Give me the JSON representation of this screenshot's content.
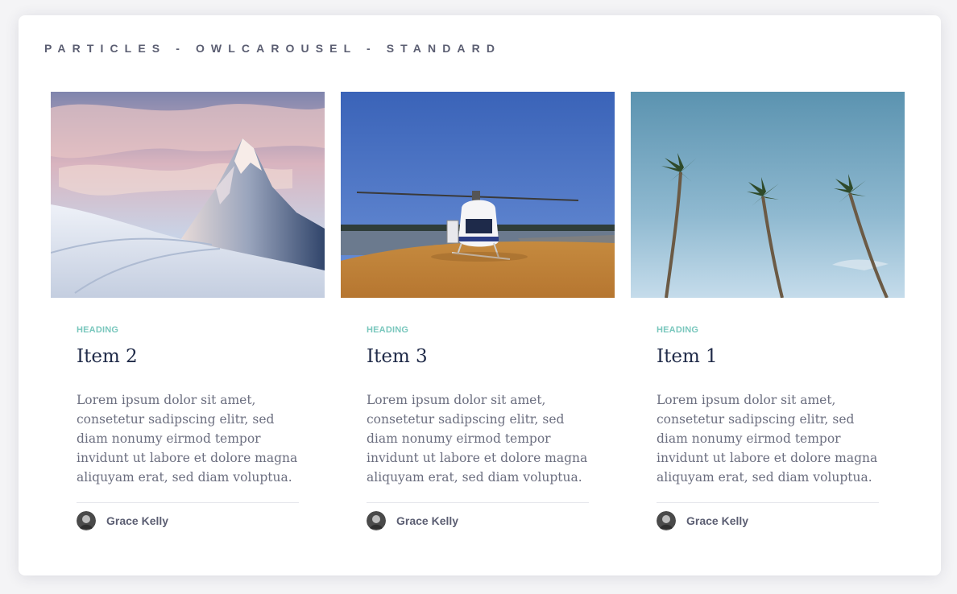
{
  "page": {
    "title": "PARTICLES - OWLCAROUSEL - STANDARD"
  },
  "cards": [
    {
      "image_icon": "mountain-photo",
      "kicker": "HEADING",
      "title": "Item 2",
      "text": "Lorem ipsum dolor sit amet, consetetur sadipscing elitr, sed diam nonumy eirmod tempor invidunt ut labore et dolore magna aliquyam erat, sed diam voluptua.",
      "author": "Grace Kelly"
    },
    {
      "image_icon": "helicopter-photo",
      "kicker": "HEADING",
      "title": "Item 3",
      "text": "Lorem ipsum dolor sit amet, consetetur sadipscing elitr, sed diam nonumy eirmod tempor invidunt ut labore et dolore magna aliquyam erat, sed diam voluptua.",
      "author": "Grace Kelly"
    },
    {
      "image_icon": "palm-trees-photo",
      "kicker": "HEADING",
      "title": "Item 1",
      "text": "Lorem ipsum dolor sit amet, consetetur sadipscing elitr, sed diam nonumy eirmod tempor invidunt ut labore et dolore magna aliquyam erat, sed diam voluptua.",
      "author": "Grace Kelly"
    }
  ],
  "colors": {
    "kicker": "#79c7bd",
    "title": "#1f2a48",
    "body_text": "#6b6e7f",
    "panel_title": "#5b5e72"
  }
}
